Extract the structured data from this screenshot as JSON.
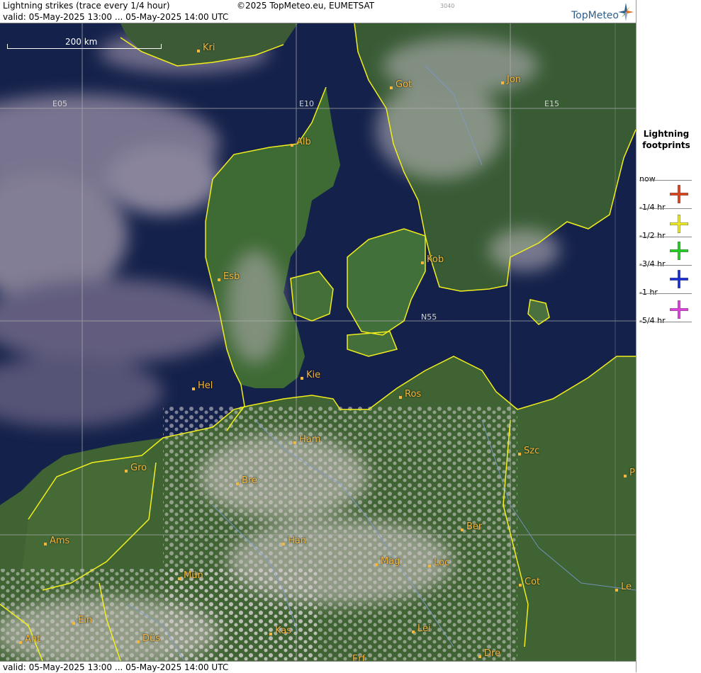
{
  "header": {
    "title": "Lightning strikes (trace every 1/4 hour)",
    "copyright": "©2025 TopMeteo.eu, EUMETSAT",
    "code": "3040",
    "valid_top": "valid:  05-May-2025 13:00 ... 05-May-2025 14:00 UTC",
    "logo": "TopMeteo"
  },
  "footer": {
    "valid_bottom": "valid:  05-May-2025 13:00 ... 05-May-2025 14:00 UTC"
  },
  "map": {
    "scale_label": "200 km",
    "grid_labels": {
      "e05": "E05",
      "e10": "E10",
      "e15": "E15",
      "n55": "N55"
    },
    "cities": {
      "kri": "Kri",
      "got": "Got",
      "jon": "Jon",
      "alb": "Alb",
      "esb": "Esb",
      "kob": "Kob",
      "hel": "Hel",
      "kie": "Kie",
      "ros": "Ros",
      "ham": "Ham",
      "szc": "Szc",
      "gro": "Gro",
      "bre": "Bre",
      "p": "P",
      "ber": "Ber",
      "ams": "Ams",
      "han": "Han",
      "mag": "Mag",
      "loc": "Loc",
      "mun": "Mün",
      "cot": "Cot",
      "le": "Le",
      "ein": "Ein",
      "kas": "Kas",
      "lei": "Lei",
      "ant": "Ant",
      "dus": "Düs",
      "dre": "Dre",
      "erf": "Erf"
    }
  },
  "legend": {
    "title_line1": "Lightning",
    "title_line2": "footprints",
    "labels": [
      "now",
      "-1/4 hr",
      "-1/2 hr",
      "-3/4 hr",
      "-1 hr",
      "-5/4 hr"
    ],
    "colors": {
      "q1": "#e0421b",
      "q2": "#f2ee1d",
      "q3": "#22d322",
      "q4": "#1a2fd6",
      "q5": "#e23fe0"
    }
  }
}
